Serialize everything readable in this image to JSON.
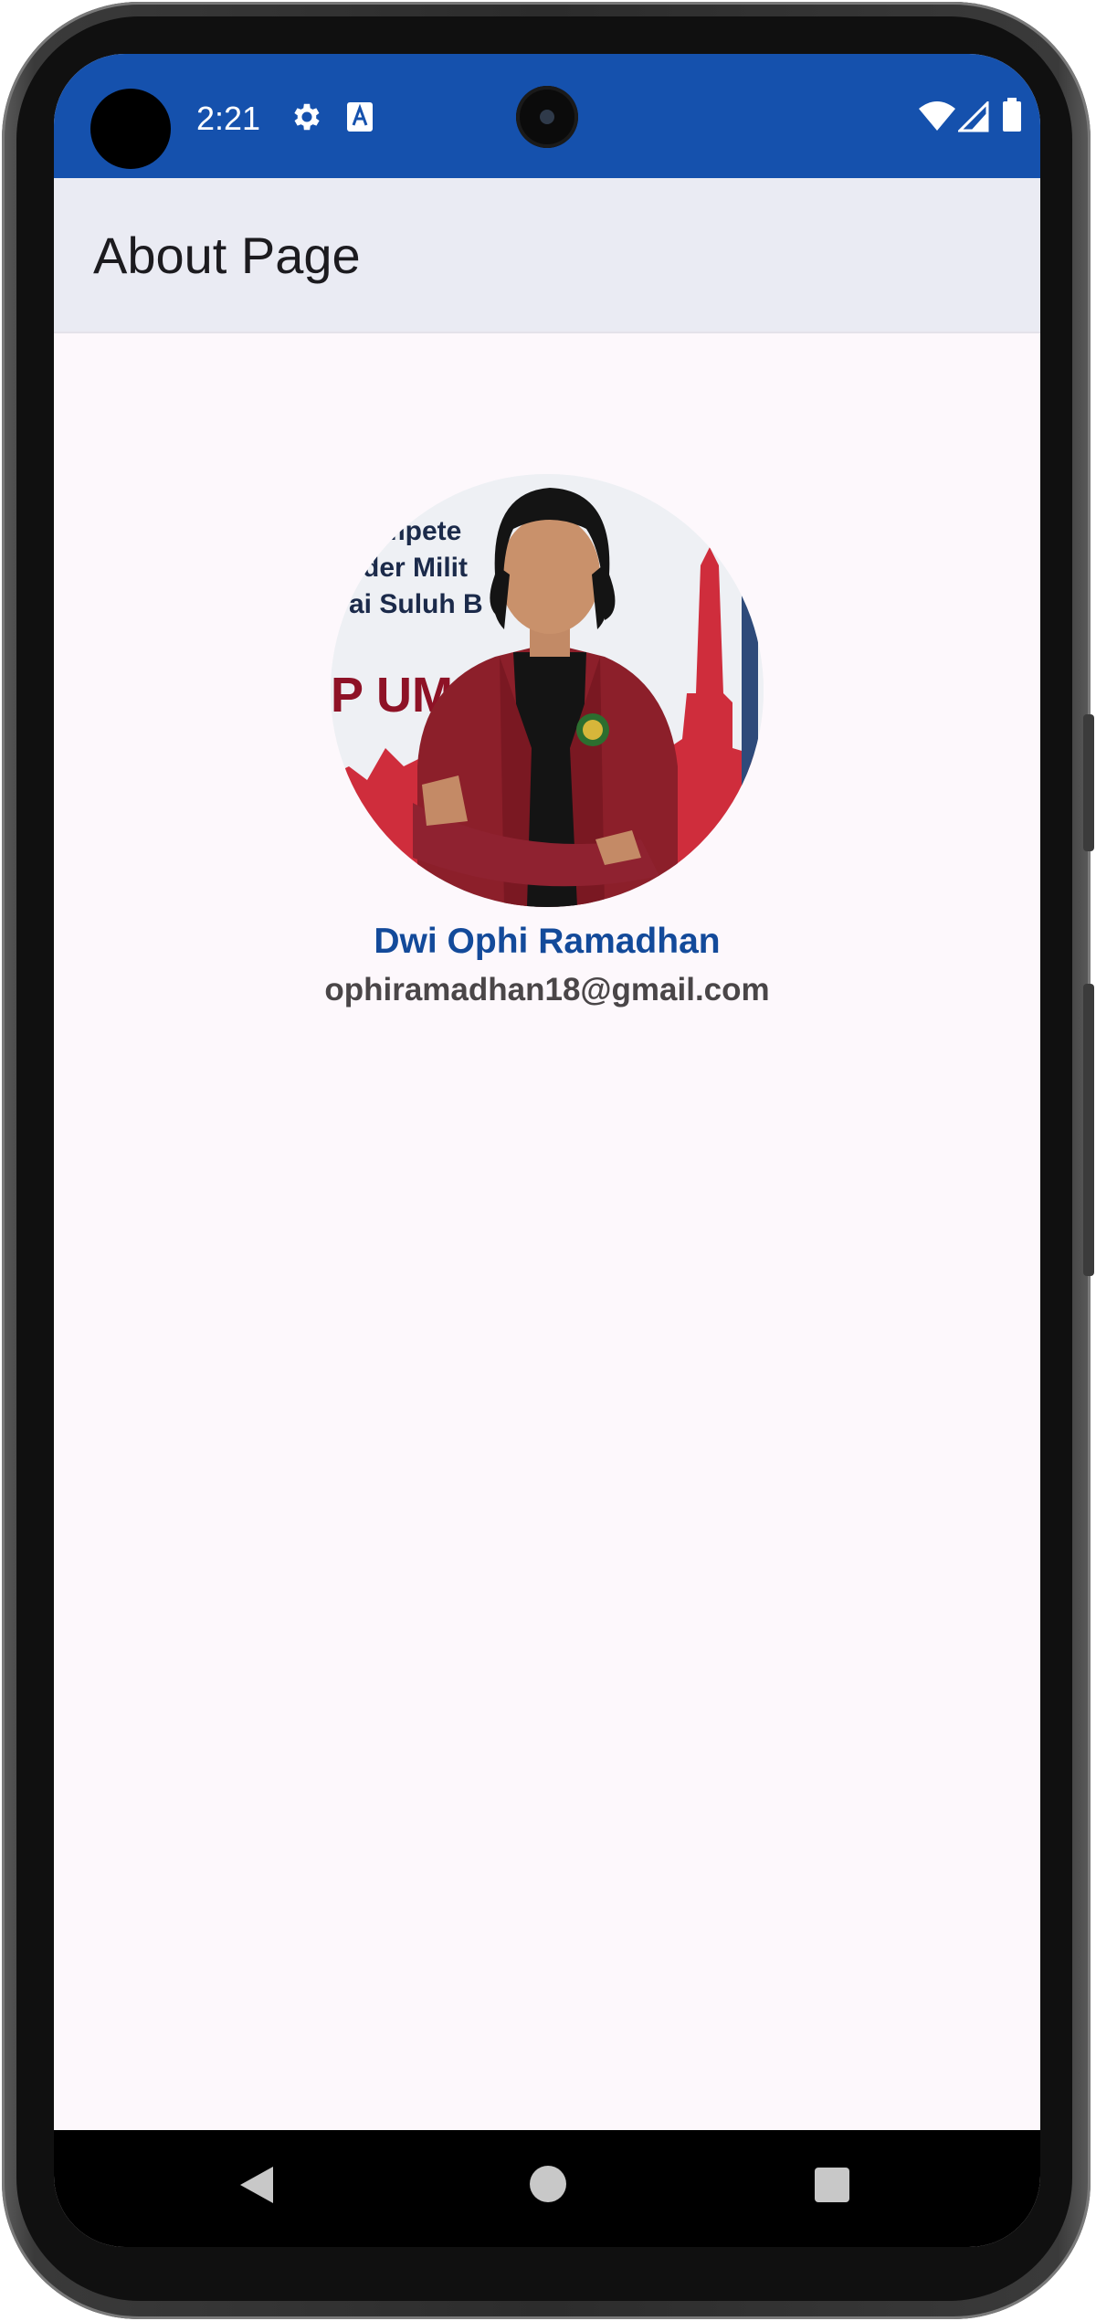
{
  "status_bar": {
    "time": "2:21",
    "icons": [
      "gear-icon",
      "text-a-icon",
      "wifi-icon",
      "cellular-signal-icon",
      "battery-icon"
    ],
    "color": "#1551ad"
  },
  "app_bar": {
    "title": "About Page",
    "color": "#eaebf3"
  },
  "profile": {
    "photo": "profile-photo",
    "photo_banner_text": [
      "mpete",
      "der Milit",
      "ai Suluh B",
      "P UM"
    ],
    "name": "Dwi Ophi Ramadhan",
    "email": "ophiramadhan18@gmail.com",
    "name_color": "#134a9a"
  },
  "nav_bar": {
    "buttons": [
      "back-icon",
      "home-icon",
      "recents-icon"
    ]
  }
}
